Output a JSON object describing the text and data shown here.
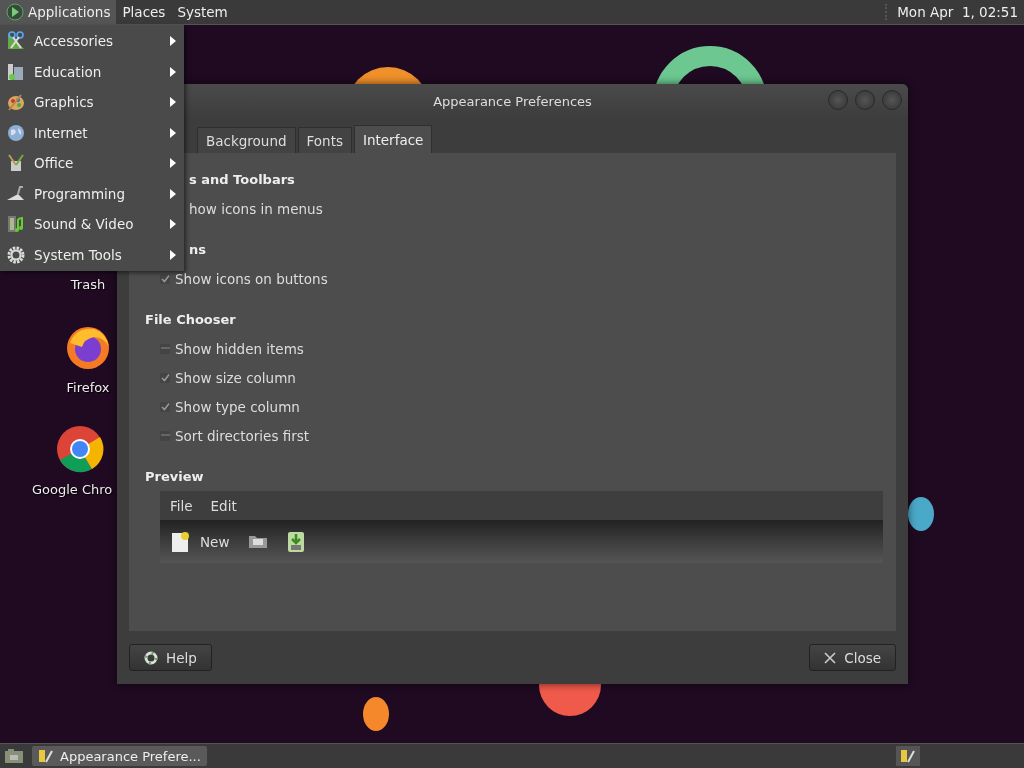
{
  "top_panel": {
    "menus": [
      {
        "label": "Applications",
        "selected": true
      },
      {
        "label": "Places",
        "selected": false
      },
      {
        "label": "System",
        "selected": false
      }
    ],
    "clock": "Mon Apr  1, 02:51"
  },
  "applications_menu": {
    "items": [
      {
        "label": "Accessories"
      },
      {
        "label": "Education"
      },
      {
        "label": "Graphics"
      },
      {
        "label": "Internet"
      },
      {
        "label": "Office"
      },
      {
        "label": "Programming"
      },
      {
        "label": "Sound & Video"
      },
      {
        "label": "System Tools"
      }
    ]
  },
  "desktop_icons": [
    {
      "kind": "trash",
      "label": "Trash"
    },
    {
      "kind": "firefox",
      "label": "Firefox"
    },
    {
      "kind": "chrome",
      "label": "Google Chro"
    }
  ],
  "window": {
    "title": "Appearance Preferences",
    "tabs": [
      {
        "label": "Background",
        "selected": false
      },
      {
        "label": "Fonts",
        "selected": false
      },
      {
        "label": "Interface",
        "selected": true
      }
    ],
    "sections": [
      {
        "heading": "s and Toolbars",
        "partly_hidden": true,
        "options": [
          {
            "label": "how icons in menus",
            "partly_hidden": true
          }
        ]
      },
      {
        "heading": "ns",
        "partly_hidden": true,
        "options": [
          {
            "label": "Show icons on buttons",
            "checked": true
          }
        ]
      },
      {
        "heading": "File Chooser",
        "options": [
          {
            "label": "Show hidden items",
            "checked": false
          },
          {
            "label": "Show size column",
            "checked": true
          },
          {
            "label": "Show type column",
            "checked": true
          },
          {
            "label": "Sort directories first",
            "checked": false
          }
        ]
      }
    ],
    "preview": {
      "heading": "Preview",
      "menus": [
        "File",
        "Edit"
      ],
      "toolbar": [
        {
          "kind": "new",
          "label": "New"
        },
        {
          "kind": "open"
        },
        {
          "kind": "save"
        }
      ]
    },
    "buttons": [
      {
        "kind": "help",
        "label": "Help"
      },
      {
        "kind": "close",
        "label": "Close"
      }
    ]
  },
  "taskbar": {
    "tasks": [
      {
        "label": "Appearance Prefere...",
        "selected": true
      }
    ]
  }
}
